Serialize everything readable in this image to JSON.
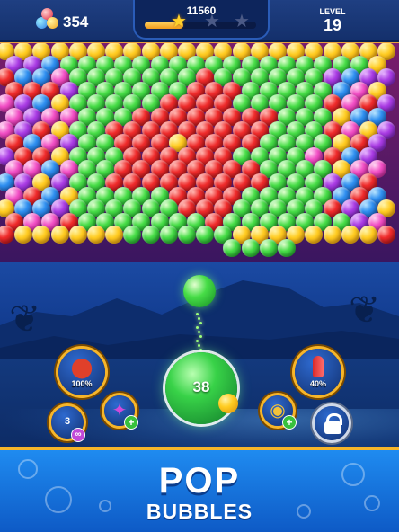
{
  "hud": {
    "coins": "354",
    "score": "11560",
    "level_label": "LEVEL",
    "level_value": "19",
    "progress": 0.35,
    "stars_earned": 1,
    "stars_total": 3
  },
  "board": {
    "colors": {
      "Y": "#ffcc22",
      "P": "#a93be3",
      "B": "#2f8ff0",
      "R": "#ef2b2b",
      "K": "#f24fc5",
      "G": "#47dd47"
    },
    "rows": [
      "YYYYYYYYYYYYYYYYYYYYYYY",
      "PPBGGGGGGGGGGGGGGGGGYR",
      "RBBKGGGGGGGRGGGGGGPBPP",
      "RRRPGGGGGGRRRGGGGGBKYB",
      "KPBYGGGGGRRRRGGGGGRKRP",
      "KPKKGGGRRRRRRRRGGGYBBK",
      "KPRYGGRRRRRRRRRGGGRKYP",
      "RBKPGGRRRYRRRRGGGGYRPK",
      "PRRYGGGRRRRRRGGGGKRBP",
      "KKBKGGRRRRRRRRGGGGYKKY",
      "BPYPGGRRRRRRRRRGGGPBR",
      "KRBYGGGGGRRRRGGGGGBRBR",
      "YBBPGGGGGGRRRGGGGGRPBY",
      "RKKRGGGGGGGRGGGGGGGPKP",
      "RYYYYYYGGGGGGYYYYYYYYR",
      "            GGGG       ",
      "            GGG        "
    ]
  },
  "shooter": {
    "balls_left": "38",
    "current_color": "green",
    "next_color": "yellow"
  },
  "boosters": {
    "bomb_percent": "100%",
    "rocket_percent": "40%",
    "swap_count": "3"
  },
  "banner": {
    "line1": "POP",
    "line2": "BUBBLES"
  }
}
